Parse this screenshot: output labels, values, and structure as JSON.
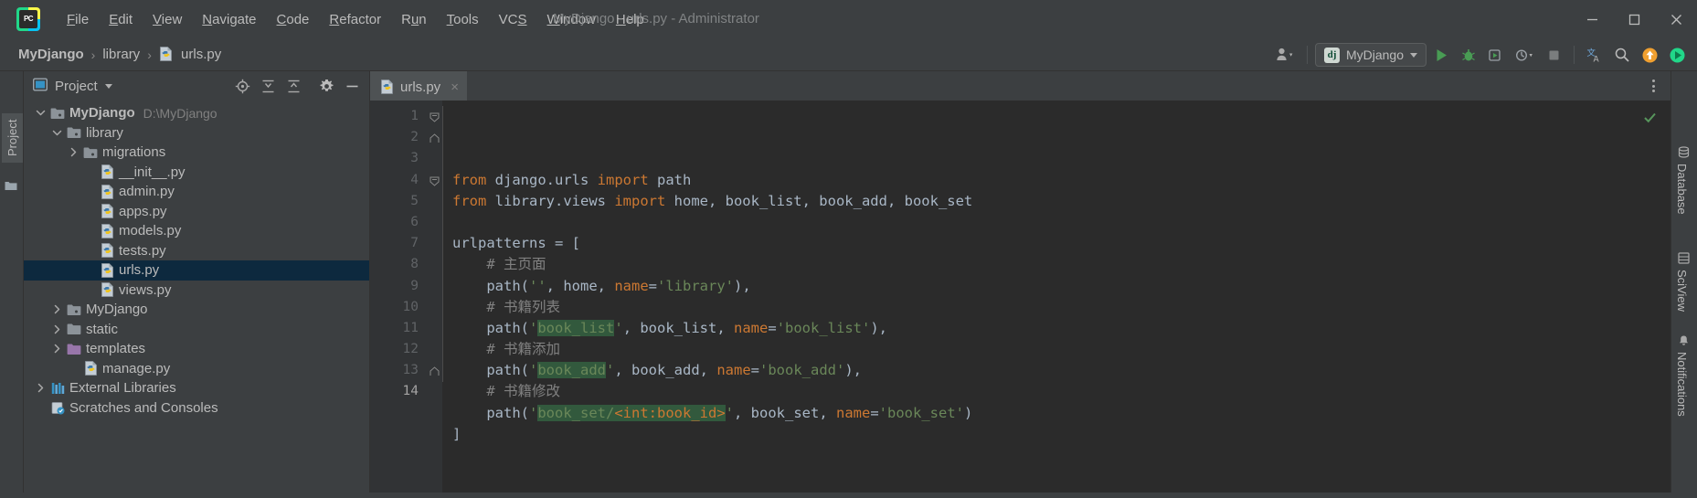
{
  "window": {
    "title": "MyDjango - urls.py - Administrator",
    "logo_text": "PC",
    "minimize_label": "Minimize",
    "maximize_label": "Maximize",
    "close_label": "Close"
  },
  "menu": [
    {
      "label": "File",
      "mnemonic": "F"
    },
    {
      "label": "Edit",
      "mnemonic": "E"
    },
    {
      "label": "View",
      "mnemonic": "V"
    },
    {
      "label": "Navigate",
      "mnemonic": "N"
    },
    {
      "label": "Code",
      "mnemonic": "C"
    },
    {
      "label": "Refactor",
      "mnemonic": "R"
    },
    {
      "label": "Run",
      "mnemonic": "u"
    },
    {
      "label": "Tools",
      "mnemonic": "T"
    },
    {
      "label": "VCS",
      "mnemonic": "S"
    },
    {
      "label": "Window",
      "mnemonic": "W"
    },
    {
      "label": "Help",
      "mnemonic": "H"
    }
  ],
  "breadcrumb": {
    "items": [
      "MyDjango",
      "library",
      "urls.py"
    ],
    "separator": "›"
  },
  "toolbar": {
    "account_icon": "user-account-icon",
    "run_config": {
      "label": "MyDjango",
      "badge": "dj"
    },
    "run_icon": "run-icon",
    "debug_icon": "debug-icon",
    "run_coverage_icon": "run-with-coverage-icon",
    "profile_icon": "profile-icon",
    "stop_icon": "stop-icon",
    "translate_icon": "translate-icon",
    "search_icon": "search-everywhere-icon",
    "update_icon": "update-project-icon",
    "ide_icon": "ide-and-project-settings-icon"
  },
  "project_panel": {
    "title": "Project",
    "dropdown_icon": "chevron-down-icon",
    "actions": [
      {
        "name": "select-opened-file-icon",
        "tooltip": "Select Opened File"
      },
      {
        "name": "expand-all-icon",
        "tooltip": "Expand All"
      },
      {
        "name": "collapse-all-icon",
        "tooltip": "Collapse All"
      },
      {
        "name": "settings-gear-icon",
        "tooltip": "Settings"
      },
      {
        "name": "hide-icon",
        "tooltip": "Hide"
      }
    ],
    "tree": [
      {
        "label": "MyDjango",
        "sub": "D:\\MyDjango",
        "depth": 0,
        "icon": "folder-module",
        "state": "expanded",
        "bold": true,
        "selected": false
      },
      {
        "label": "library",
        "sub": "",
        "depth": 1,
        "icon": "folder-source",
        "state": "expanded",
        "bold": false,
        "selected": false
      },
      {
        "label": "migrations",
        "sub": "",
        "depth": 2,
        "icon": "folder-source",
        "state": "collapsed",
        "bold": false,
        "selected": false
      },
      {
        "label": "__init__.py",
        "sub": "",
        "depth": 3,
        "icon": "python-file",
        "state": "leaf",
        "bold": false,
        "selected": false
      },
      {
        "label": "admin.py",
        "sub": "",
        "depth": 3,
        "icon": "python-file",
        "state": "leaf",
        "bold": false,
        "selected": false
      },
      {
        "label": "apps.py",
        "sub": "",
        "depth": 3,
        "icon": "python-file",
        "state": "leaf",
        "bold": false,
        "selected": false
      },
      {
        "label": "models.py",
        "sub": "",
        "depth": 3,
        "icon": "python-file",
        "state": "leaf",
        "bold": false,
        "selected": false
      },
      {
        "label": "tests.py",
        "sub": "",
        "depth": 3,
        "icon": "python-file",
        "state": "leaf",
        "bold": false,
        "selected": false
      },
      {
        "label": "urls.py",
        "sub": "",
        "depth": 3,
        "icon": "python-file",
        "state": "leaf",
        "bold": false,
        "selected": true
      },
      {
        "label": "views.py",
        "sub": "",
        "depth": 3,
        "icon": "python-file",
        "state": "leaf",
        "bold": false,
        "selected": false
      },
      {
        "label": "MyDjango",
        "sub": "",
        "depth": 1,
        "icon": "folder-source",
        "state": "collapsed",
        "bold": false,
        "selected": false
      },
      {
        "label": "static",
        "sub": "",
        "depth": 1,
        "icon": "folder-plain",
        "state": "collapsed",
        "bold": false,
        "selected": false
      },
      {
        "label": "templates",
        "sub": "",
        "depth": 1,
        "icon": "folder-templates",
        "state": "collapsed",
        "bold": false,
        "selected": false
      },
      {
        "label": "manage.py",
        "sub": "",
        "depth": 2,
        "icon": "python-file",
        "state": "leaf",
        "bold": false,
        "selected": false
      },
      {
        "label": "External Libraries",
        "sub": "",
        "depth": 0,
        "icon": "libraries",
        "state": "collapsed",
        "bold": false,
        "selected": false
      },
      {
        "label": "Scratches and Consoles",
        "sub": "",
        "depth": 0,
        "icon": "scratches",
        "state": "leaf",
        "bold": false,
        "selected": false
      }
    ]
  },
  "left_strip": {
    "tabs": [
      {
        "label": "Project",
        "active": true
      }
    ],
    "structure_icon": "structure-icon"
  },
  "right_strip": {
    "tabs": [
      {
        "label": "Database",
        "icon": "database-icon"
      },
      {
        "label": "SciView",
        "icon": "sciview-icon"
      },
      {
        "label": "Notifications",
        "icon": "notifications-icon"
      }
    ]
  },
  "editor": {
    "tabs": [
      {
        "label": "urls.py",
        "icon": "python-file",
        "active": true,
        "close": "×"
      }
    ],
    "more_actions_icon": "more-options-icon",
    "inspection_status": "ok-check-icon",
    "line_numbers": [
      "1",
      "2",
      "3",
      "4",
      "5",
      "6",
      "7",
      "8",
      "9",
      "10",
      "11",
      "12",
      "13",
      "14"
    ],
    "caret_line": 14,
    "lines": [
      {
        "n": 1,
        "fold": "start",
        "tokens": [
          {
            "t": "from ",
            "c": "kw"
          },
          {
            "t": "django.urls ",
            "c": "plain"
          },
          {
            "t": "import ",
            "c": "kw"
          },
          {
            "t": "path",
            "c": "plain"
          }
        ]
      },
      {
        "n": 2,
        "fold": "end",
        "tokens": [
          {
            "t": "from ",
            "c": "kw"
          },
          {
            "t": "library.views ",
            "c": "plain"
          },
          {
            "t": "import ",
            "c": "kw"
          },
          {
            "t": "home, book_list, book_add, book_set",
            "c": "plain"
          }
        ]
      },
      {
        "n": 3,
        "fold": "",
        "tokens": []
      },
      {
        "n": 4,
        "fold": "start",
        "tokens": [
          {
            "t": "urlpatterns = [",
            "c": "plain"
          }
        ]
      },
      {
        "n": 5,
        "fold": "",
        "tokens": [
          {
            "t": "    # 主页面",
            "c": "cmt"
          }
        ]
      },
      {
        "n": 6,
        "fold": "",
        "tokens": [
          {
            "t": "    path(",
            "c": "plain"
          },
          {
            "t": "''",
            "c": "str"
          },
          {
            "t": ", home, ",
            "c": "plain"
          },
          {
            "t": "name",
            "c": "kwarg"
          },
          {
            "t": "=",
            "c": "plain"
          },
          {
            "t": "'library'",
            "c": "str"
          },
          {
            "t": "),",
            "c": "plain"
          }
        ]
      },
      {
        "n": 7,
        "fold": "",
        "tokens": [
          {
            "t": "    # 书籍列表",
            "c": "cmt"
          }
        ]
      },
      {
        "n": 8,
        "fold": "",
        "tokens": [
          {
            "t": "    path(",
            "c": "plain"
          },
          {
            "t": "'",
            "c": "str"
          },
          {
            "t": "book_list",
            "c": "str hl"
          },
          {
            "t": "'",
            "c": "str"
          },
          {
            "t": ", book_list, ",
            "c": "plain"
          },
          {
            "t": "name",
            "c": "kwarg"
          },
          {
            "t": "=",
            "c": "plain"
          },
          {
            "t": "'book_list'",
            "c": "str"
          },
          {
            "t": "),",
            "c": "plain"
          }
        ]
      },
      {
        "n": 9,
        "fold": "",
        "tokens": [
          {
            "t": "    # 书籍添加",
            "c": "cmt"
          }
        ]
      },
      {
        "n": 10,
        "fold": "",
        "tokens": [
          {
            "t": "    path(",
            "c": "plain"
          },
          {
            "t": "'",
            "c": "str"
          },
          {
            "t": "book_add",
            "c": "str hl"
          },
          {
            "t": "'",
            "c": "str"
          },
          {
            "t": ", book_add, ",
            "c": "plain"
          },
          {
            "t": "name",
            "c": "kwarg"
          },
          {
            "t": "=",
            "c": "plain"
          },
          {
            "t": "'book_add'",
            "c": "str"
          },
          {
            "t": "),",
            "c": "plain"
          }
        ]
      },
      {
        "n": 11,
        "fold": "",
        "tokens": [
          {
            "t": "    # 书籍修改",
            "c": "cmt"
          }
        ]
      },
      {
        "n": 12,
        "fold": "",
        "tokens": [
          {
            "t": "    path(",
            "c": "plain"
          },
          {
            "t": "'",
            "c": "str"
          },
          {
            "t": "book_set/",
            "c": "str hl"
          },
          {
            "t": "<int:book_id>",
            "c": "kwarg hl"
          },
          {
            "t": "'",
            "c": "str"
          },
          {
            "t": ", book_set, ",
            "c": "plain"
          },
          {
            "t": "name",
            "c": "kwarg"
          },
          {
            "t": "=",
            "c": "plain"
          },
          {
            "t": "'book_set'",
            "c": "str"
          },
          {
            "t": ")",
            "c": "plain"
          }
        ]
      },
      {
        "n": 13,
        "fold": "end",
        "tokens": [
          {
            "t": "]",
            "c": "plain"
          }
        ]
      },
      {
        "n": 14,
        "fold": "",
        "tokens": []
      }
    ]
  },
  "colors": {
    "background": "#3c3f41",
    "editor_background": "#2b2b2b",
    "gutter_background": "#313335",
    "selection": "#0d293e",
    "keyword": "#cc7832",
    "string": "#6a8759",
    "comment": "#808080",
    "text": "#a9b7c6",
    "run_green": "#499c54",
    "highlight": "#32593d"
  }
}
